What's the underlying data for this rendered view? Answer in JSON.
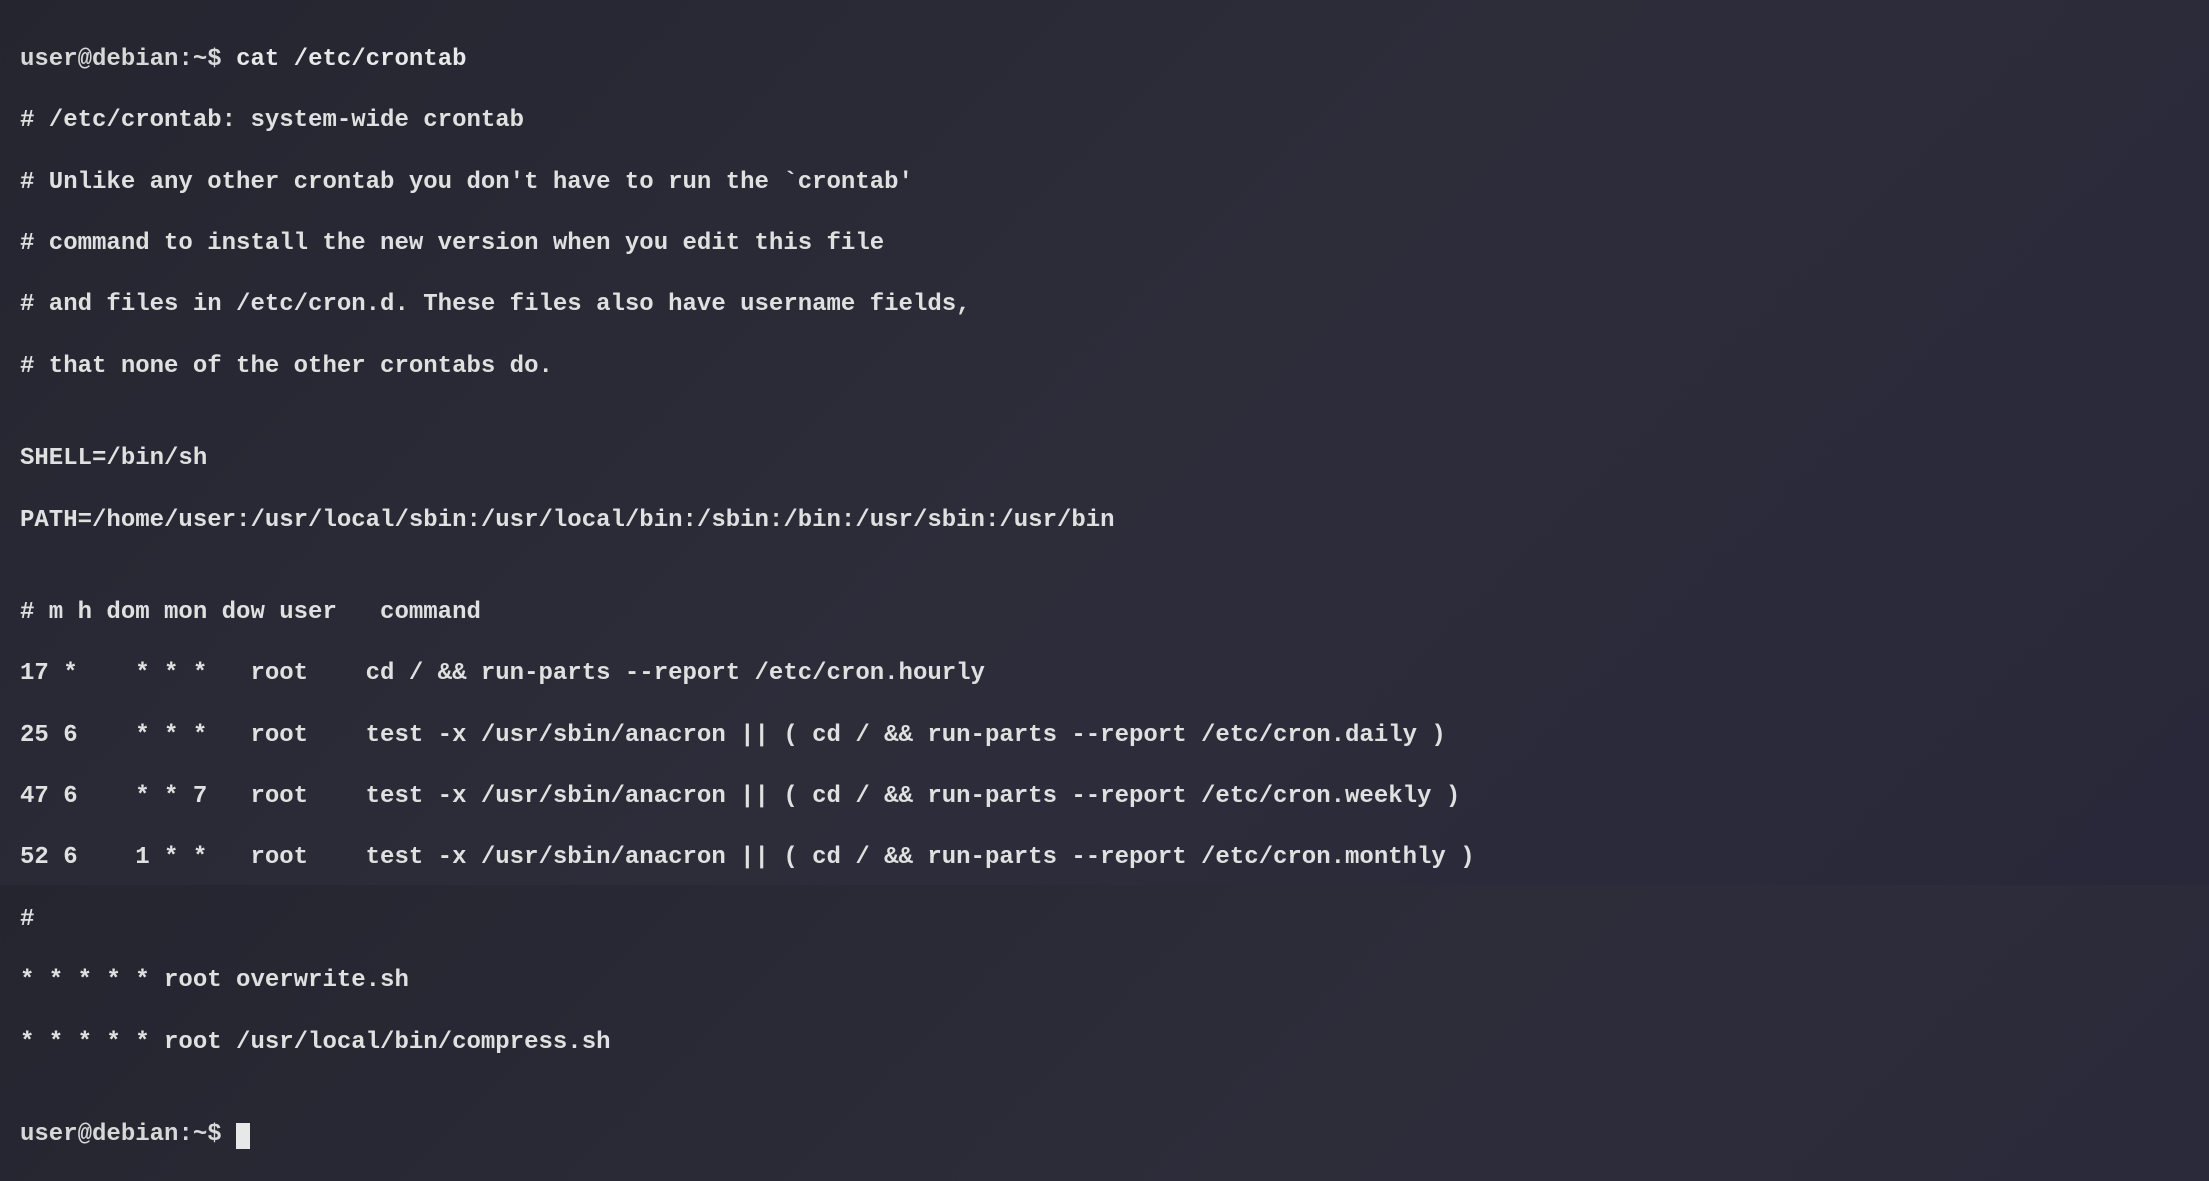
{
  "prompt1": {
    "user": "user",
    "at": "@",
    "host": "debian",
    "sep1": ":",
    "path": "~",
    "sep2": "$ ",
    "command": "cat /etc/crontab"
  },
  "output": {
    "l1": "# /etc/crontab: system-wide crontab",
    "l2": "# Unlike any other crontab you don't have to run the `crontab'",
    "l3": "# command to install the new version when you edit this file",
    "l4": "# and files in /etc/cron.d. These files also have username fields,",
    "l5": "# that none of the other crontabs do.",
    "l6": "",
    "l7": "SHELL=/bin/sh",
    "l8": "PATH=/home/user:/usr/local/sbin:/usr/local/bin:/sbin:/bin:/usr/sbin:/usr/bin",
    "l9": "",
    "l10": "# m h dom mon dow user   command",
    "l11": "17 *    * * *   root    cd / && run-parts --report /etc/cron.hourly",
    "l12": "25 6    * * *   root    test -x /usr/sbin/anacron || ( cd / && run-parts --report /etc/cron.daily )",
    "l13": "47 6    * * 7   root    test -x /usr/sbin/anacron || ( cd / && run-parts --report /etc/cron.weekly )",
    "l14": "52 6    1 * *   root    test -x /usr/sbin/anacron || ( cd / && run-parts --report /etc/cron.monthly )",
    "l15": "#",
    "l16": "* * * * * root overwrite.sh",
    "l17": "* * * * * root /usr/local/bin/compress.sh",
    "l18": ""
  },
  "prompt2": {
    "user": "user",
    "at": "@",
    "host": "debian",
    "sep1": ":",
    "path": "~",
    "sep2": "$ "
  }
}
